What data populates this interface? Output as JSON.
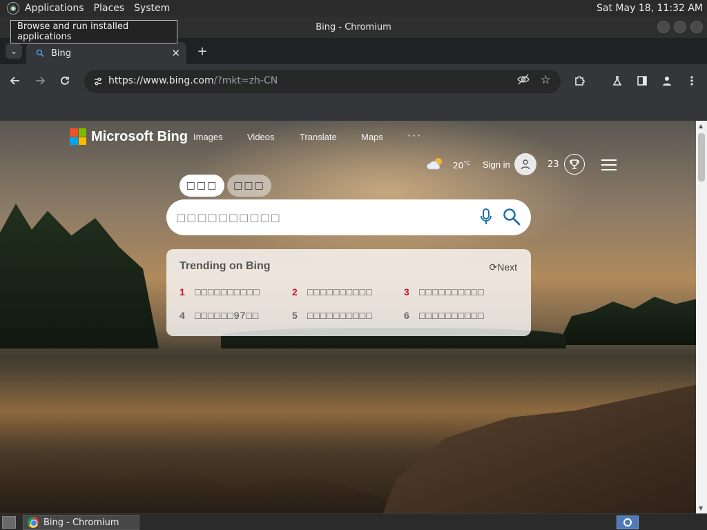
{
  "system_panel": {
    "menus": [
      "Applications",
      "Places",
      "System"
    ],
    "clock": "Sat May 18, 11:32 AM"
  },
  "tooltip": "Browse and run installed applications",
  "window": {
    "title": "Bing - Chromium"
  },
  "tabs": [
    {
      "title": "Bing",
      "favicon": "search-icon"
    }
  ],
  "toolbar": {
    "url_host": "https://www.bing.com",
    "url_path": "/?mkt=zh-CN"
  },
  "bing": {
    "logo_text": "Microsoft Bing",
    "nav": [
      "Images",
      "Videos",
      "Translate",
      "Maps"
    ],
    "nav_more": "···",
    "weather_temp": "20",
    "weather_unit": "°C",
    "sign_in": "Sign in",
    "points": "23",
    "search_tabs": [
      "□□□",
      "□□□"
    ],
    "search_placeholder": "□□□□□□□□□□",
    "trending": {
      "title": "Trending on Bing",
      "next": "Next",
      "items": [
        {
          "rank": "1",
          "text": "□□□□□□□□□□"
        },
        {
          "rank": "2",
          "text": "□□□□□□□□□□"
        },
        {
          "rank": "3",
          "text": "□□□□□□□□□□"
        },
        {
          "rank": "4",
          "text": "□□□□□□97□□"
        },
        {
          "rank": "5",
          "text": "□□□□□□□□□□"
        },
        {
          "rank": "6",
          "text": "□□□□□□□□□□"
        }
      ]
    }
  },
  "taskbar": {
    "item": "Bing - Chromium"
  },
  "colors": {
    "ms_red": "#f25022",
    "ms_green": "#7fba00",
    "ms_blue": "#00a4ef",
    "ms_yellow": "#ffb900",
    "trend_red": "#c8102e",
    "search_icon_blue": "#1e6fa8"
  }
}
